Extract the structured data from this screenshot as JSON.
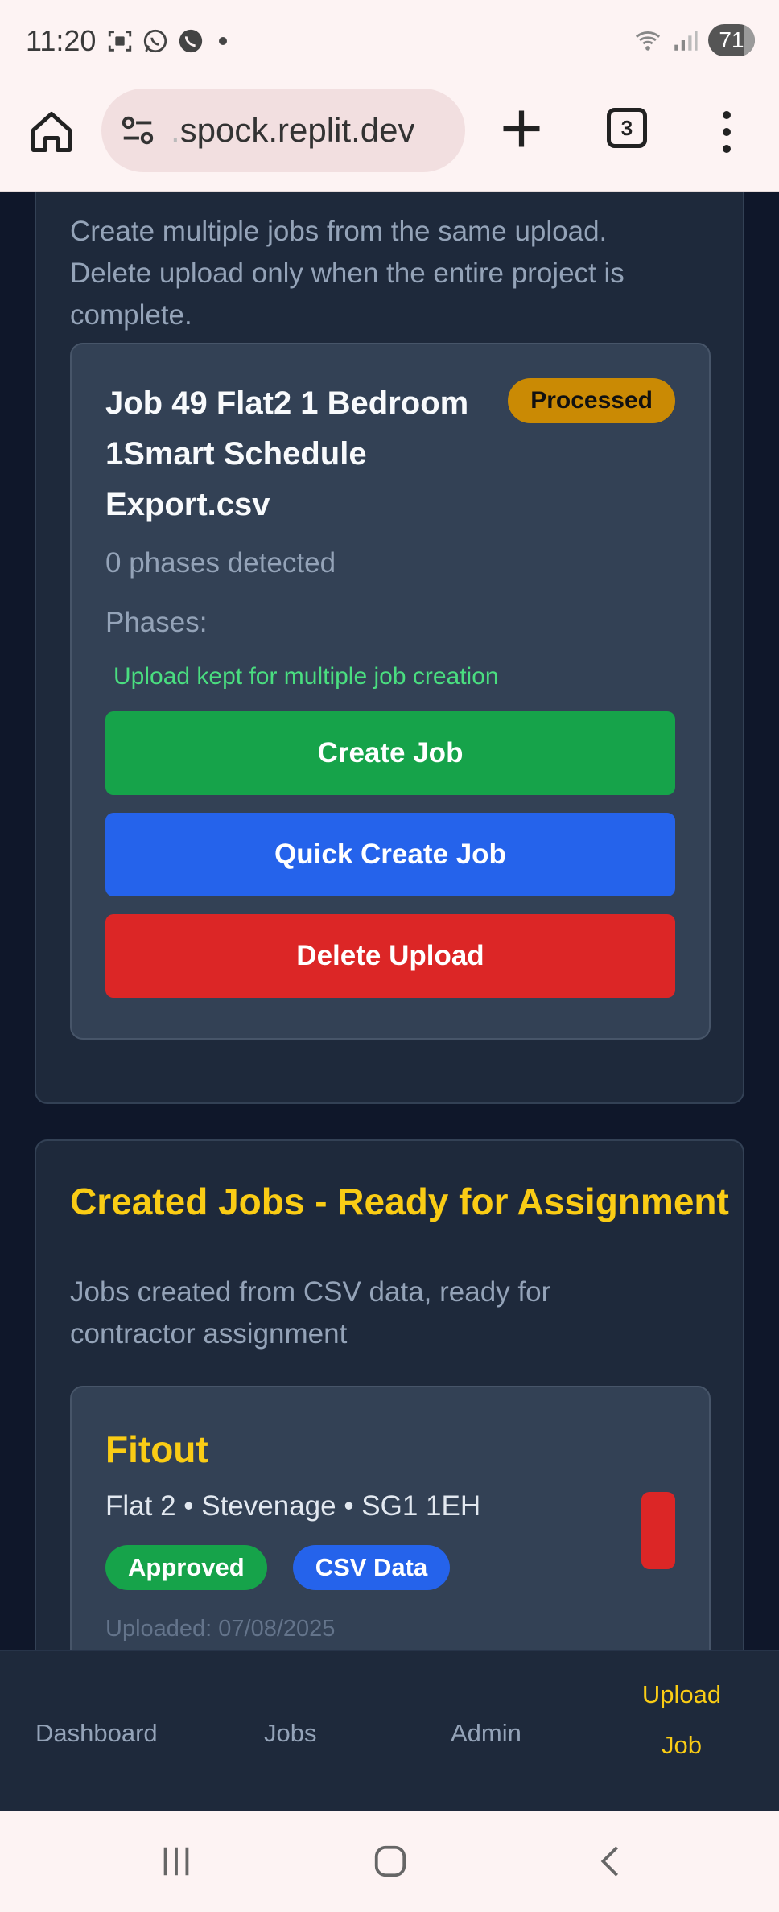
{
  "status_bar": {
    "time": "11:20",
    "battery": "71",
    "icons": [
      "screenshot-icon",
      "whatsapp-icon",
      "viber-icon",
      "notification-dot",
      "wifi-icon",
      "signal-icon",
      "battery-icon"
    ]
  },
  "browser": {
    "url_prefix": ".",
    "url": "spock.replit.dev",
    "tab_count": "3"
  },
  "upload_section": {
    "description": "Create multiple jobs from the same upload. Delete upload only when the entire project is complete.",
    "upload": {
      "title": "Job 49 Flat2 1 Bedroom 1Smart Schedule Export.csv",
      "status": "Processed",
      "phases_detected": "0 phases detected",
      "phases_label": "Phases:",
      "note": "Upload kept for multiple job creation",
      "create_label": "Create Job",
      "quick_create_label": "Quick Create Job",
      "delete_label": "Delete Upload"
    }
  },
  "created_jobs": {
    "title": "Created Jobs - Ready for Assignment",
    "description": "Jobs created from CSV data, ready for contractor assignment",
    "jobs": [
      {
        "name": "Fitout",
        "location": "Flat 2 • Stevenage • SG1 1EH",
        "status": "Approved",
        "source": "CSV Data",
        "uploaded": "Uploaded: 07/08/2025"
      }
    ]
  },
  "bottom_nav": {
    "items": [
      "Dashboard",
      "Jobs",
      "Admin"
    ],
    "active_line1": "Upload",
    "active_line2": "Job"
  },
  "colors": {
    "background": "#0f172a",
    "card": "#1e293b",
    "accent": "#facc15",
    "create": "#16a34a",
    "quick_create": "#2563eb",
    "delete": "#dc2626",
    "processed": "#ca8a04"
  }
}
